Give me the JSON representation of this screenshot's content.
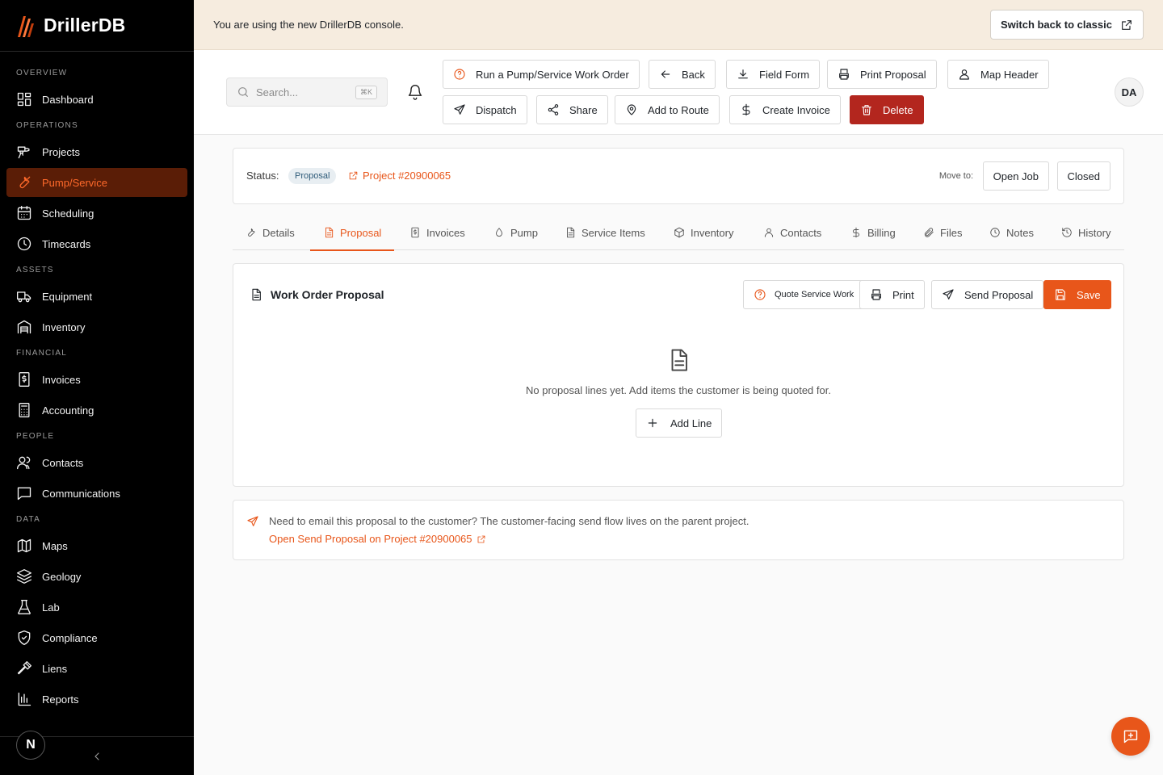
{
  "brand": {
    "name": "DrillerDB",
    "accent": "#e8561a"
  },
  "sidebar": {
    "sections": [
      {
        "title": "OVERVIEW",
        "items": [
          {
            "label": "Dashboard",
            "icon": "dashboard-icon"
          }
        ]
      },
      {
        "title": "OPERATIONS",
        "items": [
          {
            "label": "Projects",
            "icon": "drill-icon"
          },
          {
            "label": "Pump/Service",
            "icon": "wrench-icon",
            "active": true
          },
          {
            "label": "Scheduling",
            "icon": "calendar-icon"
          },
          {
            "label": "Timecards",
            "icon": "clock-icon"
          }
        ]
      },
      {
        "title": "ASSETS",
        "items": [
          {
            "label": "Equipment",
            "icon": "truck-icon"
          },
          {
            "label": "Inventory",
            "icon": "warehouse-icon"
          }
        ]
      },
      {
        "title": "FINANCIAL",
        "items": [
          {
            "label": "Invoices",
            "icon": "invoice-icon"
          },
          {
            "label": "Accounting",
            "icon": "calculator-icon"
          }
        ]
      },
      {
        "title": "PEOPLE",
        "items": [
          {
            "label": "Contacts",
            "icon": "users-icon"
          },
          {
            "label": "Communications",
            "icon": "message-icon"
          }
        ]
      },
      {
        "title": "DATA",
        "items": [
          {
            "label": "Maps",
            "icon": "map-icon"
          },
          {
            "label": "Geology",
            "icon": "layers-icon"
          },
          {
            "label": "Lab",
            "icon": "flask-icon"
          },
          {
            "label": "Compliance",
            "icon": "shield-check-icon"
          },
          {
            "label": "Liens",
            "icon": "gavel-icon"
          },
          {
            "label": "Reports",
            "icon": "bar-chart-icon"
          }
        ]
      }
    ],
    "footer_badge": "N"
  },
  "banner": {
    "text": "You are using the new DrillerDB console.",
    "button": "Switch back to classic"
  },
  "header": {
    "search_placeholder": "Search...",
    "search_shortcut": "⌘K",
    "avatar": "DA",
    "actions": {
      "run_work_order": "Run a Pump/Service Work Order",
      "back": "Back",
      "field_form": "Field Form",
      "print_proposal": "Print Proposal",
      "map_header": "Map Header",
      "dispatch": "Dispatch",
      "share": "Share",
      "add_to_route": "Add to Route",
      "create_invoice": "Create Invoice",
      "delete": "Delete"
    }
  },
  "status": {
    "label": "Status:",
    "value": "Proposal",
    "project_link": "Project #20900065",
    "move_to_label": "Move to:",
    "move_options": [
      "Open Job",
      "Closed"
    ]
  },
  "tabs": [
    {
      "label": "Details",
      "icon": "wrench-icon"
    },
    {
      "label": "Proposal",
      "icon": "file-icon",
      "active": true
    },
    {
      "label": "Invoices",
      "icon": "invoice-icon"
    },
    {
      "label": "Pump",
      "icon": "droplet-icon"
    },
    {
      "label": "Service Items",
      "icon": "file-text-icon"
    },
    {
      "label": "Inventory",
      "icon": "box-icon"
    },
    {
      "label": "Contacts",
      "icon": "user-icon"
    },
    {
      "label": "Billing",
      "icon": "dollar-icon"
    },
    {
      "label": "Files",
      "icon": "paperclip-icon"
    },
    {
      "label": "Notes",
      "icon": "clock-icon"
    },
    {
      "label": "History",
      "icon": "history-icon"
    }
  ],
  "proposal": {
    "title": "Work Order Proposal",
    "buttons": {
      "quote_service_work": "Quote Service Work",
      "print": "Print",
      "send_proposal": "Send Proposal",
      "save": "Save"
    },
    "empty_text": "No proposal lines yet. Add items the customer is being quoted for.",
    "add_line": "Add Line"
  },
  "info": {
    "text": "Need to email this proposal to the customer? The customer-facing send flow lives on the parent project.",
    "link": "Open Send Proposal on Project #20900065"
  }
}
